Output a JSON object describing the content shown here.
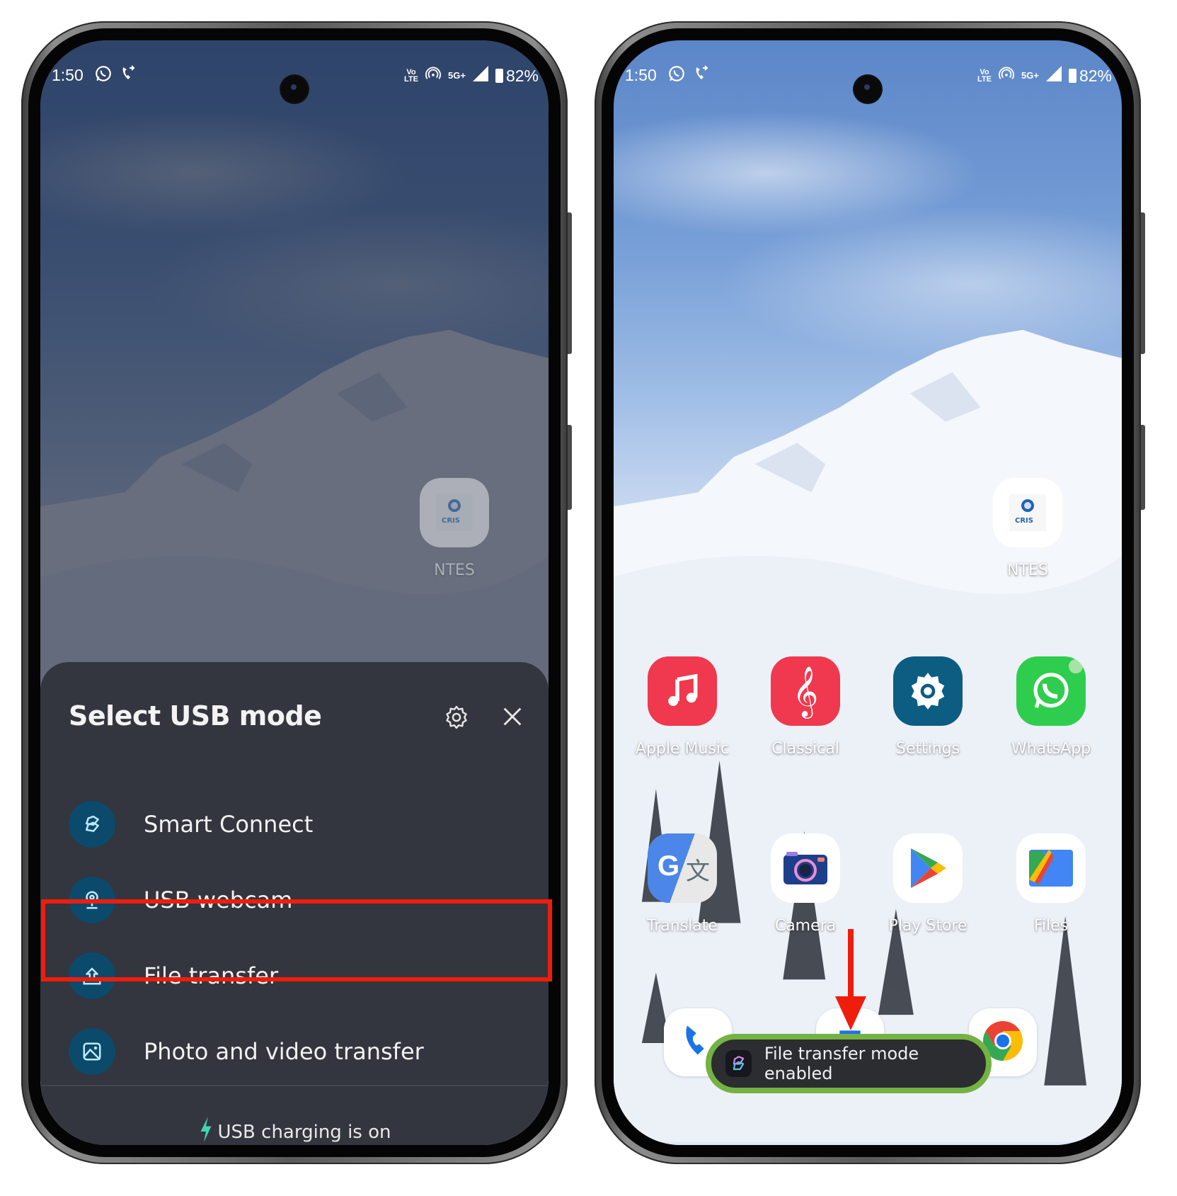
{
  "left_phone": {
    "status_bar": {
      "time": "1:50",
      "left_icons": [
        "whatsapp-icon",
        "missed-call-icon"
      ],
      "right_icons": [
        "volte-icon",
        "hotspot-icon",
        "5g-plus-icon",
        "signal-icon",
        "battery-charging-icon"
      ],
      "volte_label_top": "Vo",
      "volte_label_bottom": "LTE",
      "network_label": "5G+",
      "battery": "82%"
    },
    "home_app": {
      "label": "NTES",
      "icon": "ntes-cris-icon"
    },
    "usb_sheet": {
      "title": "Select USB mode",
      "settings_icon": "gear-icon",
      "close_icon": "close-icon",
      "options": [
        {
          "label": "Smart Connect",
          "icon": "smart-connect-icon",
          "highlighted": false
        },
        {
          "label": "USB webcam",
          "icon": "webcam-icon",
          "highlighted": false
        },
        {
          "label": "File transfer",
          "icon": "upload-icon",
          "highlighted": true
        },
        {
          "label": "Photo and video transfer",
          "icon": "image-icon",
          "highlighted": false
        }
      ],
      "footer": "USB charging is on",
      "footer_icon": "lightning-icon",
      "highlight_color": "#ef1d0b"
    }
  },
  "right_phone": {
    "status_bar": {
      "time": "1:50",
      "volte_label_top": "Vo",
      "volte_label_bottom": "LTE",
      "network_label": "5G+",
      "battery": "82%"
    },
    "apps": [
      {
        "label": "NTES",
        "icon": "ntes-cris-icon"
      },
      {
        "label": "Apple Music",
        "icon": "music-note-icon",
        "color": "#f0384e"
      },
      {
        "label": "Classical",
        "icon": "treble-clef-icon",
        "color": "#f0384e"
      },
      {
        "label": "Settings",
        "icon": "gear-icon",
        "color": "#0d5c82"
      },
      {
        "label": "WhatsApp",
        "icon": "whatsapp-icon",
        "color": "#2fcd4d"
      },
      {
        "label": "Translate",
        "icon": "google-translate-icon"
      },
      {
        "label": "Camera",
        "icon": "camera-icon"
      },
      {
        "label": "Play Store",
        "icon": "play-store-icon"
      },
      {
        "label": "Files",
        "icon": "files-icon"
      }
    ],
    "dock": [
      {
        "name": "phone",
        "icon": "phone-icon"
      },
      {
        "name": "messages",
        "icon": "messages-icon"
      },
      {
        "name": "chrome",
        "icon": "chrome-icon"
      }
    ],
    "toast": {
      "text": "File transfer mode enabled",
      "icon": "smart-connect-icon",
      "highlight_color": "#74b243"
    },
    "annotation_arrow_color": "#ef1d0b"
  }
}
